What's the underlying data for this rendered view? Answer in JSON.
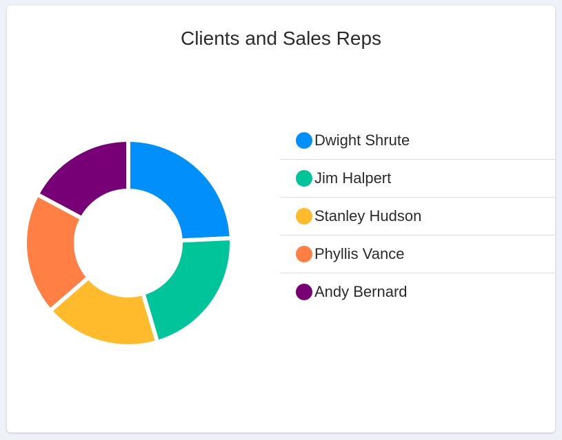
{
  "chart_data": {
    "type": "donut",
    "title": "Clients and Sales Reps",
    "legend_position": "right",
    "categories": [
      "Dwight Shrute",
      "Jim Halpert",
      "Stanley Hudson",
      "Phyllis Vance",
      "Andy Bernard"
    ],
    "values": [
      24,
      21,
      18,
      19,
      17
    ],
    "colors": [
      "#008ffb",
      "#00c49a",
      "#ffbb2c",
      "#ff7f45",
      "#770077"
    ]
  }
}
